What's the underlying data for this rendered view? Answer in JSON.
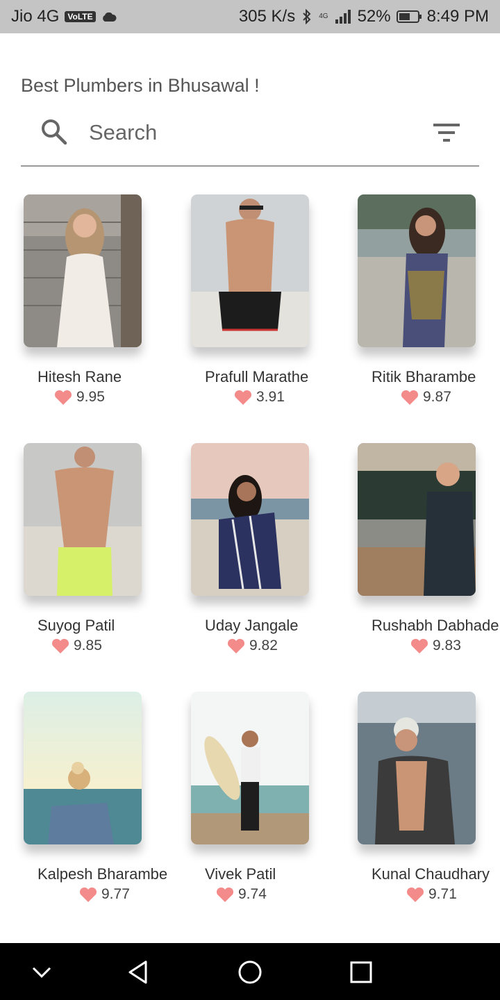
{
  "status_bar": {
    "carrier": "Jio 4G",
    "volte": "VoLTE",
    "speed": "305 K/s",
    "network": "4G",
    "battery": "52%",
    "time": "8:49 PM"
  },
  "header": {
    "title": "Best Plumbers in Bhusawal !"
  },
  "search": {
    "placeholder": "Search"
  },
  "colors": {
    "heart": "#f48b8b",
    "divider": "#9a9a9a"
  },
  "cards": [
    {
      "name": "Hitesh Rane",
      "rating": "9.95"
    },
    {
      "name": "Prafull Marathe",
      "rating": "3.91"
    },
    {
      "name": "Ritik Bharambe",
      "rating": "9.87"
    },
    {
      "name": "Suyog Patil",
      "rating": "9.85"
    },
    {
      "name": "Uday Jangale",
      "rating": "9.82"
    },
    {
      "name": "Rushabh Dabhade",
      "rating": "9.83"
    },
    {
      "name": "Kalpesh Bharambe",
      "rating": "9.77"
    },
    {
      "name": "Vivek Patil",
      "rating": "9.74"
    },
    {
      "name": "Kunal Chaudhary",
      "rating": "9.71"
    }
  ]
}
